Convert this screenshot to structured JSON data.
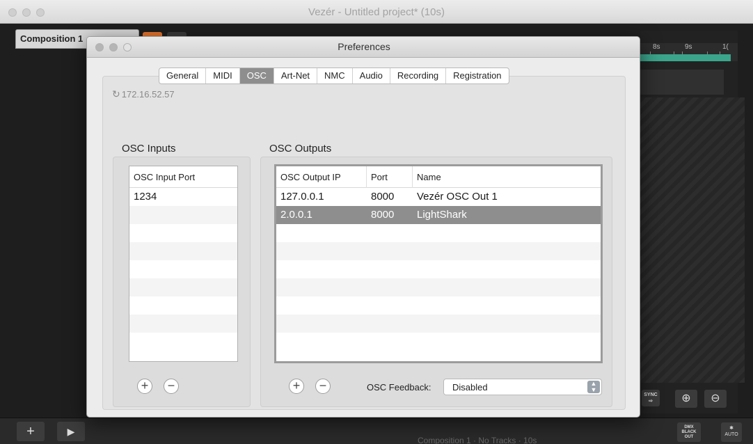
{
  "window": {
    "title": "Vezér - Untitled project* (10s)",
    "composition_tab": "Composition 1",
    "ruler_labels": [
      "8s",
      "9s",
      "1("
    ],
    "sync_label": "SYNC",
    "zoom_in_icon": "zoom-in-icon",
    "zoom_out_icon": "zoom-out-icon",
    "blackout_label": "DMX BLACK OUT",
    "auto_label": "AUTO",
    "status_text": "Composition 1 · No Tracks · 10s"
  },
  "dialog": {
    "title": "Preferences",
    "tabs": [
      "General",
      "MIDI",
      "OSC",
      "Art-Net",
      "NMC",
      "Audio",
      "Recording",
      "Registration"
    ],
    "active_tab": "OSC",
    "ip_address": "172.16.52.57",
    "inputs": {
      "label": "OSC Inputs",
      "column": "OSC Input Port",
      "rows": [
        "1234"
      ]
    },
    "outputs": {
      "label": "OSC Outputs",
      "columns": [
        "OSC Output IP",
        "Port",
        "Name"
      ],
      "rows": [
        {
          "ip": "127.0.0.1",
          "port": "8000",
          "name": "Vezér OSC Out 1"
        },
        {
          "ip": "2.0.0.1",
          "port": "8000",
          "name": "LightShark"
        }
      ],
      "selected_row": 1
    },
    "feedback": {
      "label": "OSC Feedback:",
      "value": "Disabled"
    },
    "add_symbol": "+",
    "remove_symbol": "−"
  }
}
